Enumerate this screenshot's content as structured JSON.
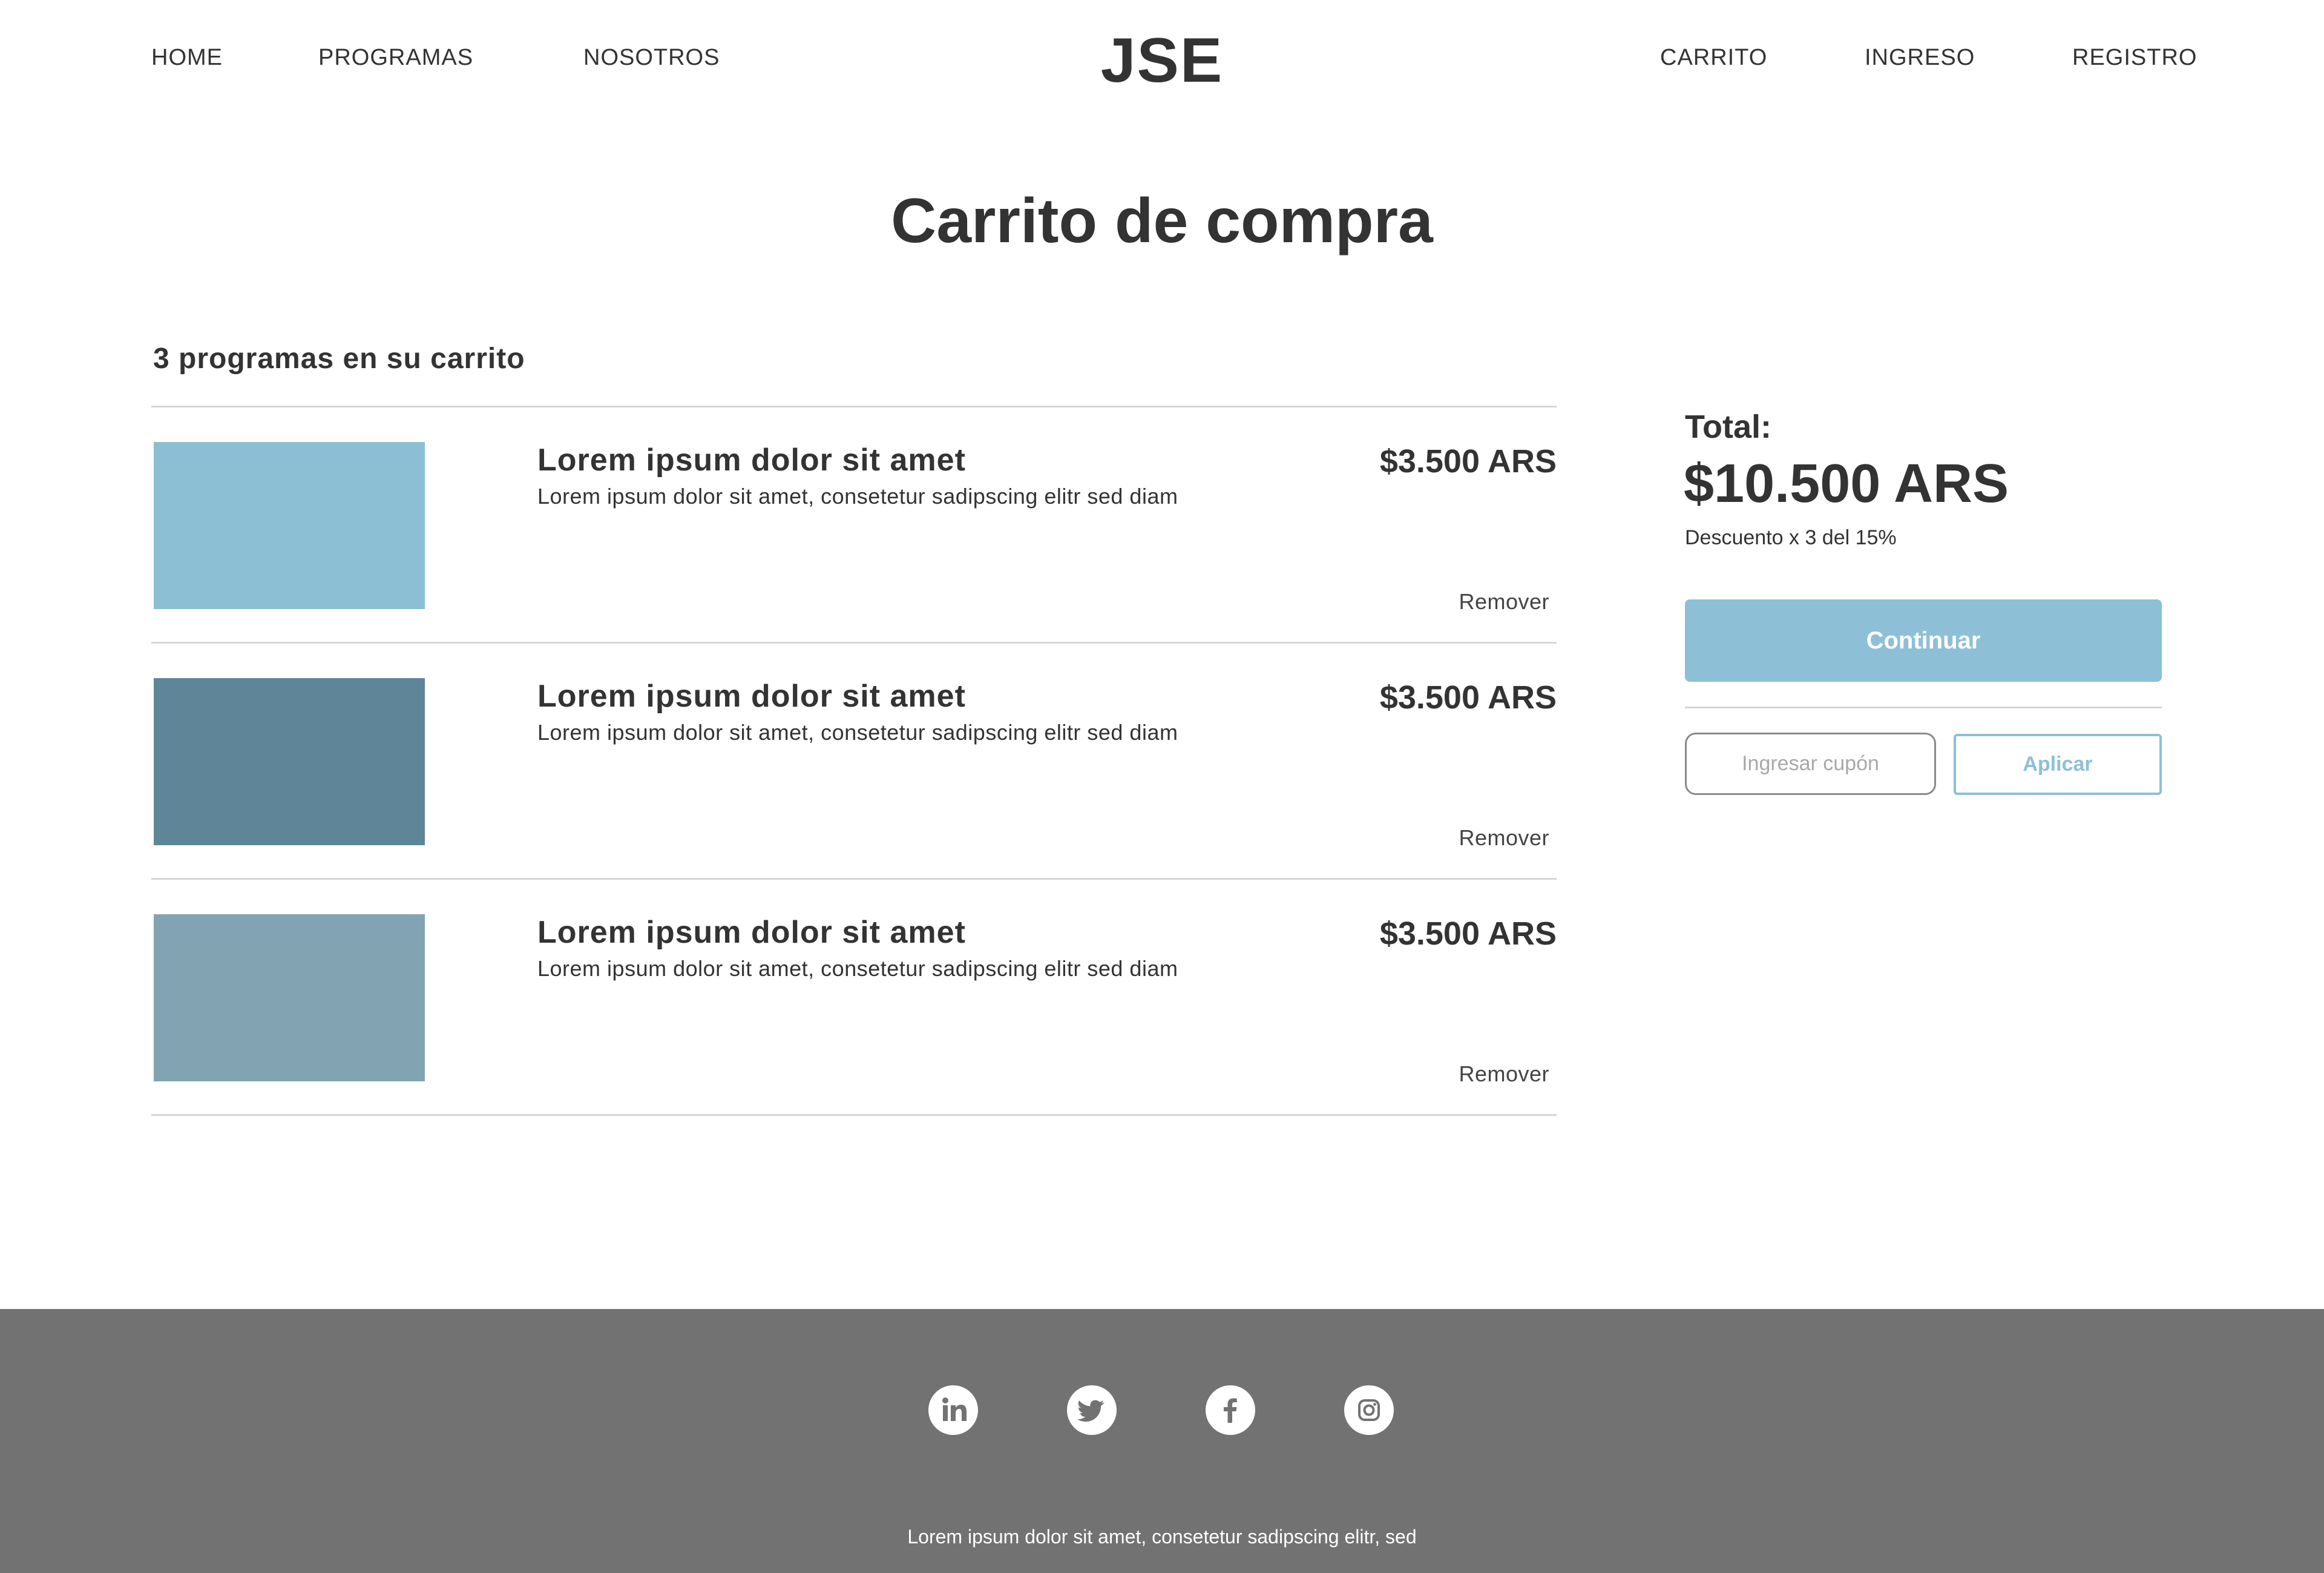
{
  "header": {
    "nav_left": [
      "HOME",
      "PROGRAMAS",
      "NOSOTROS"
    ],
    "logo": "JSE",
    "nav_right": [
      "CARRITO",
      "INGRESO",
      "REGISTRO"
    ]
  },
  "page": {
    "title": "Carrito de compra",
    "cart_count": "3 programas en su carrito"
  },
  "cart": {
    "items": [
      {
        "title": "Lorem ipsum dolor sit amet",
        "description": "Lorem ipsum dolor sit amet, consetetur sadipscing elitr sed diam",
        "price": "$3.500 ARS",
        "remove_label": "Remover",
        "thumb_color": "#8cbfd4"
      },
      {
        "title": "Lorem ipsum dolor sit amet",
        "description": "Lorem ipsum dolor sit amet, consetetur sadipscing elitr sed diam",
        "price": "$3.500 ARS",
        "remove_label": "Remover",
        "thumb_color": "#5e8698"
      },
      {
        "title": "Lorem ipsum dolor sit amet",
        "description": "Lorem ipsum dolor sit amet, consetetur sadipscing elitr sed diam",
        "price": "$3.500 ARS",
        "remove_label": "Remover",
        "thumb_color": "#82a3b2"
      }
    ]
  },
  "summary": {
    "total_label": "Total:",
    "total_amount": "$10.500 ARS",
    "discount_note": "Descuento x 3 del 15%",
    "continue_label": "Continuar",
    "coupon_placeholder": "Ingresar cupón",
    "apply_label": "Aplicar"
  },
  "footer": {
    "social_icons": [
      "linkedin-icon",
      "twitter-icon",
      "facebook-icon",
      "instagram-icon"
    ],
    "text": "Lorem ipsum dolor sit amet, consetetur sadipscing elitr, sed"
  },
  "colors": {
    "accent": "#8dc0d6",
    "text": "#333333",
    "footer_bg": "#727272"
  }
}
